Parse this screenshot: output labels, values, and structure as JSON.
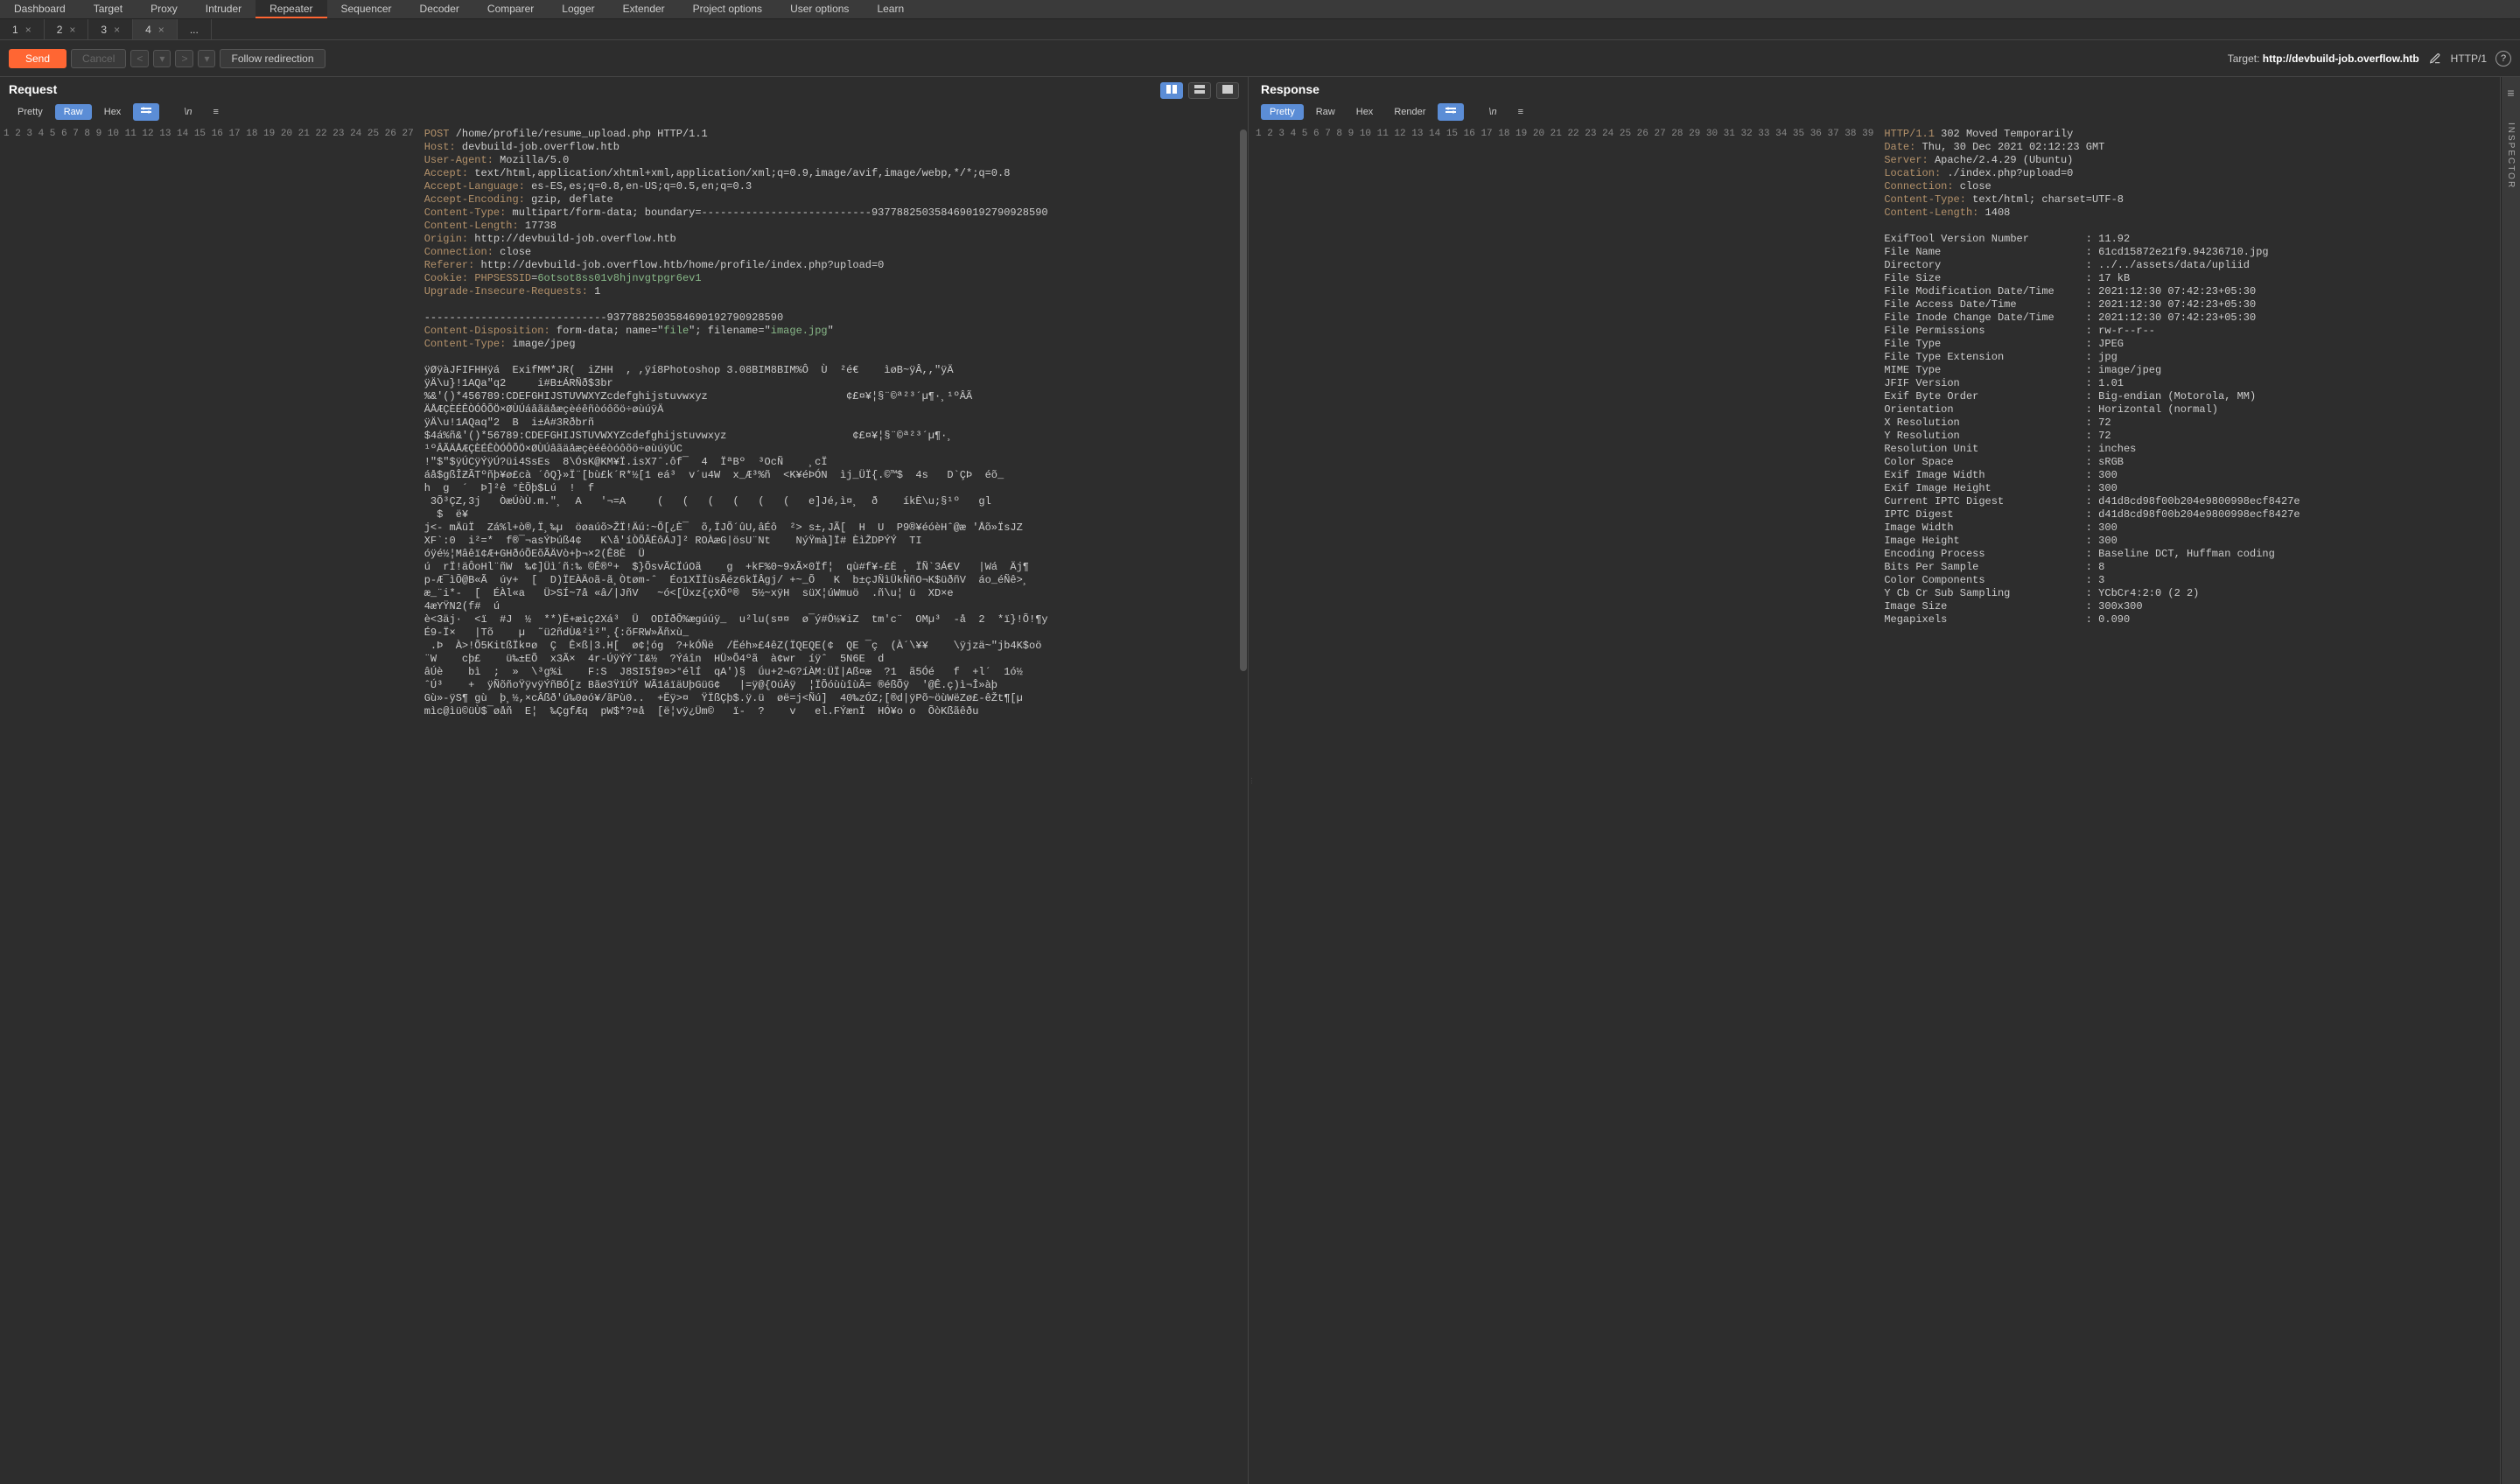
{
  "topTabs": [
    "Dashboard",
    "Target",
    "Proxy",
    "Intruder",
    "Repeater",
    "Sequencer",
    "Decoder",
    "Comparer",
    "Logger",
    "Extender",
    "Project options",
    "User options",
    "Learn"
  ],
  "topActive": 4,
  "subTabs": [
    "1",
    "2",
    "3",
    "4",
    "..."
  ],
  "subActive": 3,
  "toolbar": {
    "send": "Send",
    "cancel": "Cancel",
    "followRedirect": "Follow redirection",
    "targetLabel": "Target:",
    "targetValue": "http://devbuild-job.overflow.htb",
    "proto": "HTTP/1"
  },
  "request": {
    "title": "Request",
    "tabs": [
      "Pretty",
      "Raw",
      "Hex"
    ],
    "active": 1,
    "lines": [
      {
        "n": 1,
        "pre": "",
        "kw": "POST",
        "post": " /home/profile/resume_upload.php HTTP/1.1"
      },
      {
        "n": 2,
        "pre": "",
        "kw": "Host:",
        "post": " devbuild-job.overflow.htb"
      },
      {
        "n": 3,
        "pre": "",
        "kw": "User-Agent:",
        "post": " Mozilla/5.0"
      },
      {
        "n": 4,
        "pre": "",
        "kw": "Accept:",
        "post": " text/html,application/xhtml+xml,application/xml;q=0.9,image/avif,image/webp,*/*;q=0.8"
      },
      {
        "n": 5,
        "pre": "",
        "kw": "Accept-Language:",
        "post": " es-ES,es;q=0.8,en-US;q=0.5,en;q=0.3"
      },
      {
        "n": 6,
        "pre": "",
        "kw": "Accept-Encoding:",
        "post": " gzip, deflate"
      },
      {
        "n": 7,
        "pre": "",
        "kw": "Content-Type:",
        "post": " multipart/form-data; boundary=---------------------------9377882503584690192790928590"
      },
      {
        "n": 8,
        "pre": "",
        "kw": "Content-Length:",
        "post": " 17738"
      },
      {
        "n": 9,
        "pre": "",
        "kw": "Origin:",
        "post": " http://devbuild-job.overflow.htb"
      },
      {
        "n": 10,
        "pre": "",
        "kw": "Connection:",
        "post": " close"
      },
      {
        "n": 11,
        "pre": "",
        "kw": "Referer:",
        "post": " http://devbuild-job.overflow.htb/home/profile/index.php?upload=0"
      },
      {
        "n": 12,
        "pre": "",
        "kw": "Cookie:",
        "post": " ",
        "kw2": "PHPSESSID",
        "post2": "=",
        "str": "6otsot8ss01v8hjnvgtpgr6ev1"
      },
      {
        "n": 13,
        "pre": "",
        "kw": "Upgrade-Insecure-Requests:",
        "post": " 1"
      },
      {
        "n": 14,
        "pre": ""
      },
      {
        "n": 15,
        "pre": "-----------------------------9377882503584690192790928590"
      },
      {
        "n": 16,
        "pre": "",
        "kw": "Content-Disposition:",
        "post": " form-data; name=\"",
        "str": "file",
        "post2": "\"; filename=\"",
        "str2": "image.jpg",
        "post3": "\""
      },
      {
        "n": 17,
        "pre": "",
        "kw": "Content-Type:",
        "post": " image/jpeg"
      },
      {
        "n": 18,
        "pre": ""
      },
      {
        "n": 19,
        "pre": "ÿØÿàJFIFHHÿá  ExifMM*JR(  iZHH  , ,ÿí8Photoshop 3.08BIM8BIM%Ô  Ù  ²é€    ìøB~ÿÂ,,\"ÿÄ"
      },
      {
        "n": 20,
        "pre": "ÿÄ\\u}!1AQa\"q2     i#B±ÁRÑð$3br"
      },
      {
        "n": 21,
        "pre": "%&'()*456789:CDEFGHIJSTUVWXYZcdefghijstuvwxyz                      ¢£¤¥¦§¨©ª²³´µ¶·¸¹ºÂÃ"
      },
      {
        "n": "",
        "pre": "ÄÅÆÇÈÉÊÒÓÔÕÖ×ØÙÚáâãäåæçèéêñòóôõö÷øùúÿÄ"
      },
      {
        "n": 22,
        "pre": "ÿÄ\\u!1AQaq\"2  B  i±Á#3Rðbrñ"
      },
      {
        "n": 23,
        "pre": "$4á%ñ&'()*56789:CDEFGHIJSTUVWXYZcdefghijstuvwxyz                    ¢£¤¥¦§¨©ª²³´µ¶·¸"
      },
      {
        "n": "",
        "pre": "¹ºÂÃÄÅÆÇÈÉÊÒÓÔÕÖ×ØÙÚâãäåæçèéêòóôõö÷øùúÿÚC"
      },
      {
        "n": "",
        "pre": "!\"$\"$ÿÚCÿÝÿÚ?üi4SsEs  8\\ÓsK@KM¥Ï.isX7ˆ.ôf¯  4  ÏªBº  ³OcÑ    ¸cÏ"
      },
      {
        "n": 24,
        "pre": "áå$gßÎƵÃTºñþ¥ø£cà ´ôQ}»Ï¨[bù£k´R*½[1 eá³  v´u4W  x_Æ³%ñ  <K¥éÞÓN  ìj_ÜÏ{.©™$  4s   D`ÇÞ  éõ_"
      },
      {
        "n": "",
        "pre": "h  g  ´  Þ]²ê °ÈÕþ$Lú  !  f"
      },
      {
        "n": "",
        "pre": " 3Õ³ÇZ,3j   ÒæÚòÙ.m.\"¸  A   '¬=A     (   (   (   (   (   (   e]Jé,ì¤¸  ð    íkÈ\\u;§¹º   gl"
      },
      {
        "n": "",
        "pre": "  $  ë¥"
      },
      {
        "n": "",
        "pre": "j<- mÄüÏ  Zá%l+ò®,Ï¸‰µ  öøaúõ>ŽÏ!Äú:~Õ[¿È¯  õ,ÏJÕ´ûU,âÉô  ²> s±,JÃ[  H  U  P9®¥éóèHˆ@æ 'Åõ»ÏsJZ"
      },
      {
        "n": "",
        "pre": "XF`:0  i²=*  f®¯¬asÝÞúß4¢   K\\å'íÒÕÃÉôÁJ]² ROÀæG|ösU¨Nt    NýŸmà]Ï# ÈìŽDPÝÝ  TI"
      },
      {
        "n": 25,
        "pre": "óÿé½¦Mâêï¢Æ+GHðóÕEõÃÄVò+þ¬×2(Ê8È  Ü"
      },
      {
        "n": "",
        "pre": "ú  rÏ!äÔoHl¨ñW  ‰¢]Üì´ñ:‰ ©Ê®º+  $}ÕsvÃCÏúOã    g  +kF%0~9xÃ×0Ïf¦  qù#f¥-£È ¸ ÏÑ`3Á€V   |Wá  Äj¶"
      },
      {
        "n": "",
        "pre": "p-Æ¯ìÕ@B«Ã  úy+  [  D)ÏEÀÄoã-ã¸Òtøm-ˆ  Éo1XÏÏùsÃéz6kÏÂgj/ +~_Õ   K  b±çJÑìÜkÑñO¬K$üðñV  áo_éÑê>¸"
      },
      {
        "n": "",
        "pre": "æ_¨i*-  [  ÉÀl«a   Ü>SÍ~7å «â/|JñV   ~ó<[Üxz{çXÕº®  5½~xÿH  süX¦úWmuö  .ñ\\u¦ ü  XD×e"
      },
      {
        "n": 26,
        "pre": "4æYŸN2(f#  ú"
      },
      {
        "n": 27,
        "pre": "è<3äj·  <ï  #J  ½  **)Ë+æìç2Xá³  Ü  ODÏðÕ%ægúúÿ_  u²lu(s¤¤  ø¯ý#Ö½¥iZ  tm'c¨  OMµ³  -å  2  *ï}!Õ!¶y"
      },
      {
        "n": "",
        "pre": "É9-Ï×   |Tõ    µ  ˜ü2ñdÙ&²ì²\"¸{:õFRW»Ãñxù_"
      },
      {
        "n": "",
        "pre": " .Þ  À>!Õ5KitßÏk¤ø  Ç  Ê×ß|3.H[  ø¢¦óg  ?+kÓÑë  /Ëéh»£4êZ(ÏQEQE(¢  QE ¯ç  (À´\\¥¥    \\ÿjzä~\"jb4K$oö"
      },
      {
        "n": "",
        "pre": "¨W    cþ£    ü‰±EÕ  x3Ã×  4r-ÚÿÝÝˆI&½  ?Ýáîn  HÜ»Õ4ºã  à¢wr  íÿˆ  5N6E  d"
      },
      {
        "n": "",
        "pre": "âÚè    bì  ;  »  \\³g%i    F:S  J8SI5Í9¤>°élÍ  qA')§  ǘu+2¬G?íÀM:ÜÏ|Aß¤æ  ?1  ã5Óé   f  +l´  1ó½"
      },
      {
        "n": "",
        "pre": "ˆÚ³    +  ÿÑõñoŸÿvÿÝñBÓ[z Bãø3ŸïÚŸ WÃ1áïäUþGüG¢   |=ÿ@{OúÄÿ  ¦ÏÕóùùîùÃ= ®éßÕÿ  '@Ê.ç)ì¬Î»àþ"
      },
      {
        "n": "",
        "pre": "Gù»-ÿS¶ gù  þ¸½,×cÂßð'ú‰0øó¥/ãPù0..  +Ëÿ>¤  ŸÏßÇþ$.ÿ.ü  øë=j<Ñú]  40‰zÓZ;[®d|ÿPõ~öùWëZø£-êŽt¶[µ"
      },
      {
        "n": "",
        "pre": "mìc@ìü©üÙ$¯øåñ  E¦  ‰ÇgfÆq  pW$*?¤å  [ë¦vÿ¿Üm©   ï-  ?    v   el.FÝænÏ  HÓ¥o o  ÕòKßãêðu"
      },
      {
        "n": "",
        "pre": "",
        "kw": "",
        "post": ""
      }
    ]
  },
  "response": {
    "title": "Response",
    "tabs": [
      "Pretty",
      "Raw",
      "Hex",
      "Render"
    ],
    "active": 0,
    "lines": [
      {
        "n": 1,
        "pre": "",
        "kw": "HTTP/1.1",
        "post": " 302 Moved Temporarily"
      },
      {
        "n": 2,
        "pre": "",
        "kw": "Date:",
        "post": " Thu, 30 Dec 2021 02:12:23 GMT"
      },
      {
        "n": 3,
        "pre": "",
        "kw": "Server:",
        "post": " Apache/2.4.29 (Ubuntu)"
      },
      {
        "n": 4,
        "pre": "",
        "kw": "Location:",
        "post": " ./index.php?upload=0"
      },
      {
        "n": 5,
        "pre": "",
        "kw": "Connection:",
        "post": " close"
      },
      {
        "n": 6,
        "pre": "",
        "kw": "Content-Type:",
        "post": " text/html; charset=UTF-8"
      },
      {
        "n": 7,
        "pre": "",
        "kw": "Content-Length:",
        "post": " 1408"
      },
      {
        "n": 8,
        "pre": ""
      },
      {
        "n": 9,
        "pre": "ExifTool Version Number         : 11.92"
      },
      {
        "n": 10,
        "pre": "File Name                       : 61cd15872e21f9.94236710.jpg"
      },
      {
        "n": 11,
        "pre": "Directory                       : ../../assets/data/upliid"
      },
      {
        "n": 12,
        "pre": "File Size                       : 17 kB"
      },
      {
        "n": 13,
        "pre": "File Modification Date/Time     : 2021:12:30 07:42:23+05:30"
      },
      {
        "n": 14,
        "pre": "File Access Date/Time           : 2021:12:30 07:42:23+05:30"
      },
      {
        "n": 15,
        "pre": "File Inode Change Date/Time     : 2021:12:30 07:42:23+05:30"
      },
      {
        "n": 16,
        "pre": "File Permissions                : rw-r--r--"
      },
      {
        "n": 17,
        "pre": "File Type                       : JPEG"
      },
      {
        "n": 18,
        "pre": "File Type Extension             : jpg"
      },
      {
        "n": 19,
        "pre": "MIME Type                       : image/jpeg"
      },
      {
        "n": 20,
        "pre": "JFIF Version                    : 1.01"
      },
      {
        "n": 21,
        "pre": "Exif Byte Order                 : Big-endian (Motorola, MM)"
      },
      {
        "n": 22,
        "pre": "Orientation                     : Horizontal (normal)"
      },
      {
        "n": 23,
        "pre": "X Resolution                    : 72"
      },
      {
        "n": 24,
        "pre": "Y Resolution                    : 72"
      },
      {
        "n": 25,
        "pre": "Resolution Unit                 : inches"
      },
      {
        "n": 26,
        "pre": "Color Space                     : sRGB"
      },
      {
        "n": 27,
        "pre": "Exif Image Width                : 300"
      },
      {
        "n": 28,
        "pre": "Exif Image Height               : 300"
      },
      {
        "n": 29,
        "pre": "Current IPTC Digest             : d41d8cd98f00b204e9800998ecf8427e"
      },
      {
        "n": 30,
        "pre": "IPTC Digest                     : d41d8cd98f00b204e9800998ecf8427e"
      },
      {
        "n": 31,
        "pre": "Image Width                     : 300"
      },
      {
        "n": 32,
        "pre": "Image Height                    : 300"
      },
      {
        "n": 33,
        "pre": "Encoding Process                : Baseline DCT, Huffman coding"
      },
      {
        "n": 34,
        "pre": "Bits Per Sample                 : 8"
      },
      {
        "n": 35,
        "pre": "Color Components                : 3"
      },
      {
        "n": 36,
        "pre": "Y Cb Cr Sub Sampling            : YCbCr4:2:0 (2 2)"
      },
      {
        "n": 37,
        "pre": "Image Size                      : 300x300"
      },
      {
        "n": 38,
        "pre": "Megapixels                      : 0.090"
      },
      {
        "n": 39,
        "pre": ""
      }
    ]
  },
  "inspector": "INSPECTOR"
}
